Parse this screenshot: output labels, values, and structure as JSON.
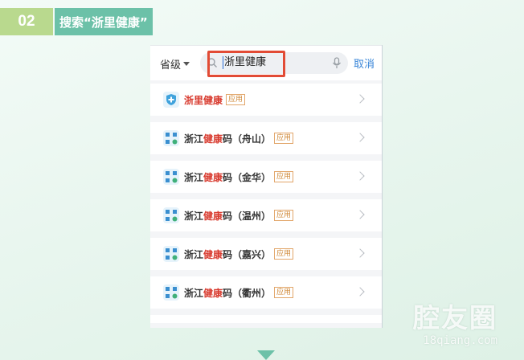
{
  "step": {
    "number": "02",
    "title": "搜索“浙里健康”"
  },
  "search": {
    "province_label": "省级",
    "query": "浙里健康",
    "cancel_label": "取消"
  },
  "results": [
    {
      "before": "",
      "highlight": "浙里健康",
      "after": "",
      "tag": "应用",
      "icon": "shield-plus-icon"
    },
    {
      "before": "浙江",
      "highlight": "健康",
      "after": "码（舟山）",
      "tag": "应用",
      "icon": "qr-code-icon"
    },
    {
      "before": "浙江",
      "highlight": "健康",
      "after": "码（金华）",
      "tag": "应用",
      "icon": "qr-code-icon"
    },
    {
      "before": "浙江",
      "highlight": "健康",
      "after": "码（温州）",
      "tag": "应用",
      "icon": "qr-code-icon"
    },
    {
      "before": "浙江",
      "highlight": "健康",
      "after": "码（嘉兴）",
      "tag": "应用",
      "icon": "qr-code-icon"
    },
    {
      "before": "浙江",
      "highlight": "健康",
      "after": "码（衢州）",
      "tag": "应用",
      "icon": "qr-code-icon"
    }
  ],
  "watermark": {
    "main": "腔友圈",
    "url": "18qiang.com"
  },
  "colors": {
    "step_number_bg": "#b9d98e",
    "step_title_bg": "#6cc1a8",
    "highlight_text": "#d83a2e",
    "annotation_box": "#e24b35",
    "cancel_link": "#3a86d8",
    "tag": "#d08a3a"
  }
}
